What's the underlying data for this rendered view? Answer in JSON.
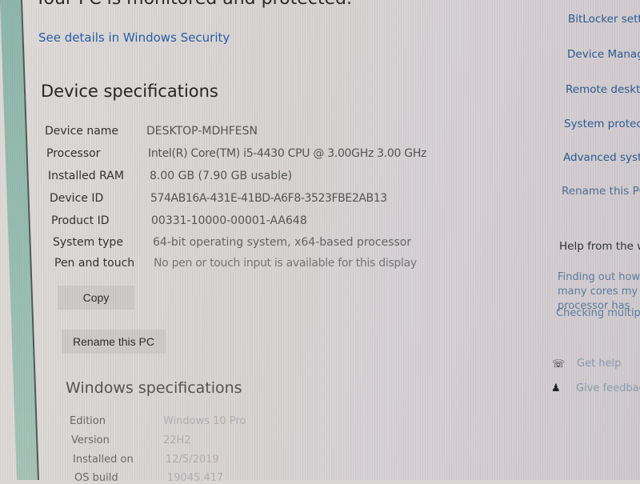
{
  "header": {
    "status_text": "Your PC is monitored and protected.",
    "security_link": "See details in Windows Security"
  },
  "device_specs": {
    "title": "Device specifications",
    "rows": [
      {
        "label": "Device name",
        "value": "DESKTOP-MDHFESN"
      },
      {
        "label": "Processor",
        "value": "Intel(R) Core(TM) i5-4430 CPU @ 3.00GHz   3.00 GHz"
      },
      {
        "label": "Installed RAM",
        "value": "8.00 GB (7.90 GB usable)"
      },
      {
        "label": "Device ID",
        "value": "574AB16A-431E-41BD-A6F8-3523FBE2AB13"
      },
      {
        "label": "Product ID",
        "value": "00331-10000-00001-AA648"
      },
      {
        "label": "System type",
        "value": "64-bit operating system, x64-based processor"
      },
      {
        "label": "Pen and touch",
        "value": "No pen or touch input is available for this display"
      }
    ],
    "copy_button": "Copy",
    "rename_button": "Rename this PC"
  },
  "windows_specs": {
    "title": "Windows specifications",
    "rows": [
      {
        "label": "Edition",
        "value": "Windows 10 Pro"
      },
      {
        "label": "Version",
        "value": "22H2"
      },
      {
        "label": "Installed on",
        "value": "12/5/2019"
      },
      {
        "label": "OS build",
        "value": "19045.417"
      }
    ]
  },
  "related_settings": {
    "links": [
      "BitLocker settings",
      "Device Manager",
      "Remote desktop",
      "System protection",
      "Advanced system settings",
      "Rename this PC (advanced)"
    ]
  },
  "help": {
    "heading": "Help from the web",
    "links": [
      "Finding out how many cores my processor has",
      "Checking multiple languages support"
    ],
    "get_help": "Get help",
    "give_feedback": "Give feedback"
  }
}
